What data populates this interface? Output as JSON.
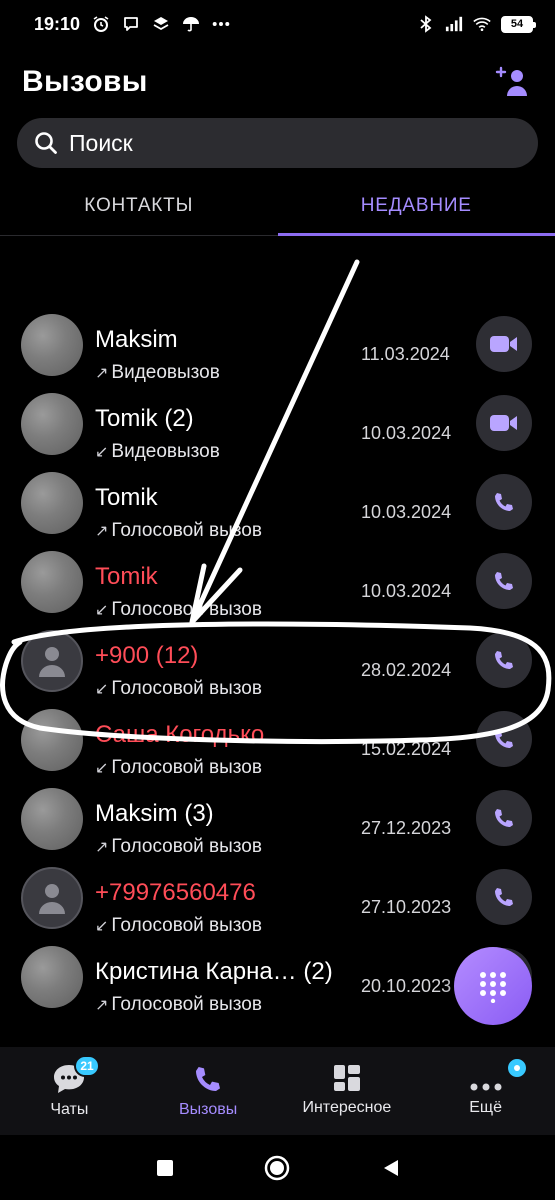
{
  "status_bar": {
    "time": "19:10",
    "battery": "54"
  },
  "header": {
    "title": "Вызовы"
  },
  "search": {
    "placeholder": "Поиск"
  },
  "tabs": [
    {
      "label": "КОНТАКТЫ",
      "active": false
    },
    {
      "label": "НЕДАВНИЕ",
      "active": true
    }
  ],
  "calls": [
    {
      "name": "Maksim",
      "missed": false,
      "direction": "outgoing",
      "arrow": "↗",
      "type": "Видеовызов",
      "date": "11.03.2024",
      "action_icon": "video-icon"
    },
    {
      "name": "Tomik (2)",
      "missed": false,
      "direction": "incoming",
      "arrow": "↙",
      "type": "Видеовызов",
      "date": "10.03.2024",
      "action_icon": "video-icon"
    },
    {
      "name": "Tomik",
      "missed": false,
      "direction": "outgoing",
      "arrow": "↗",
      "type": "Голосовой вызов",
      "date": "10.03.2024",
      "action_icon": "phone-icon"
    },
    {
      "name": "Tomik",
      "missed": true,
      "direction": "incoming",
      "arrow": "↙",
      "type": "Голосовой вызов",
      "date": "10.03.2024",
      "action_icon": "phone-icon"
    },
    {
      "name": "+900 (12)",
      "missed": true,
      "direction": "incoming",
      "arrow": "↙",
      "type": "Голосовой вызов",
      "date": "28.02.2024",
      "action_icon": "phone-icon"
    },
    {
      "name": "Саша Когодько",
      "missed": true,
      "direction": "incoming",
      "arrow": "↙",
      "type": "Голосовой вызов",
      "date": "15.02.2024",
      "action_icon": "phone-icon"
    },
    {
      "name": "Maksim (3)",
      "missed": false,
      "direction": "outgoing",
      "arrow": "↗",
      "type": "Голосовой вызов",
      "date": "27.12.2023",
      "action_icon": "phone-icon"
    },
    {
      "name": "+79976560476",
      "missed": true,
      "direction": "incoming",
      "arrow": "↙",
      "type": "Голосовой вызов",
      "date": "27.10.2023",
      "action_icon": "phone-icon"
    },
    {
      "name": "Кристина Карна…  (2)",
      "missed": false,
      "direction": "outgoing",
      "arrow": "↗",
      "type": "Голосовой вызов",
      "date": "20.10.2023",
      "action_icon": "phone-icon"
    }
  ],
  "bottom_nav": [
    {
      "label": "Чаты",
      "icon": "chat-icon",
      "badge": "21",
      "active": false
    },
    {
      "label": "Вызовы",
      "icon": "phone-icon",
      "active": true
    },
    {
      "label": "Интересное",
      "icon": "explore-icon",
      "active": false
    },
    {
      "label": "Ещё",
      "icon": "more-icon",
      "dot": true,
      "active": false
    }
  ],
  "colors": {
    "accent": "#a58cff",
    "missed": "#ff4d58",
    "badge": "#38c9ff",
    "background": "#000000"
  }
}
